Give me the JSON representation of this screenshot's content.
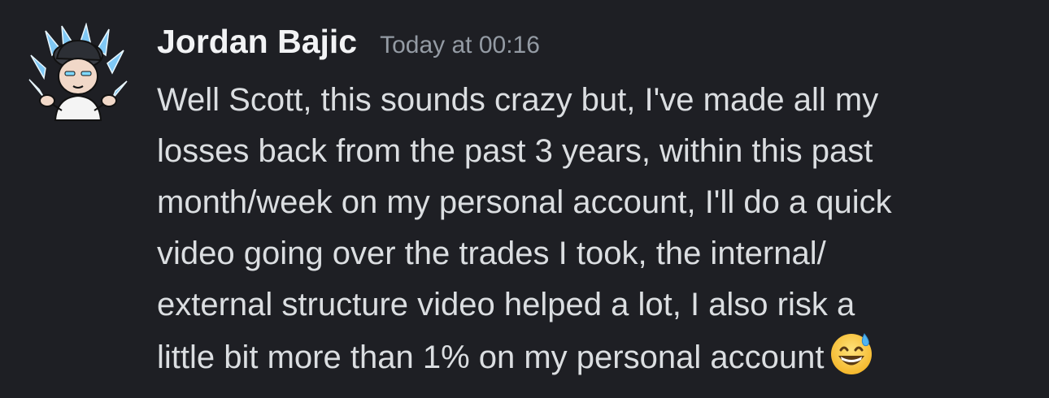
{
  "author": {
    "name": "Jordan Bajic",
    "avatar_icon": "anime-character-avatar-icon"
  },
  "timestamp": "Today at 00:16",
  "message": {
    "lines": [
      "Well Scott, this sounds crazy but, I've made all my",
      "losses back from the past 3 years, within this past",
      "month/week on my personal account, I'll do a quick",
      "video going over the trades I took, the internal/",
      "external structure video helped a lot, I also risk a",
      "little bit more than 1% on my personal account"
    ],
    "trailing_emoji": "grinning-face-with-sweat-icon"
  },
  "colors": {
    "background": "#1e1f24",
    "username": "#f2f3f5",
    "timestamp": "#949ba4",
    "text": "#dbdee1"
  }
}
